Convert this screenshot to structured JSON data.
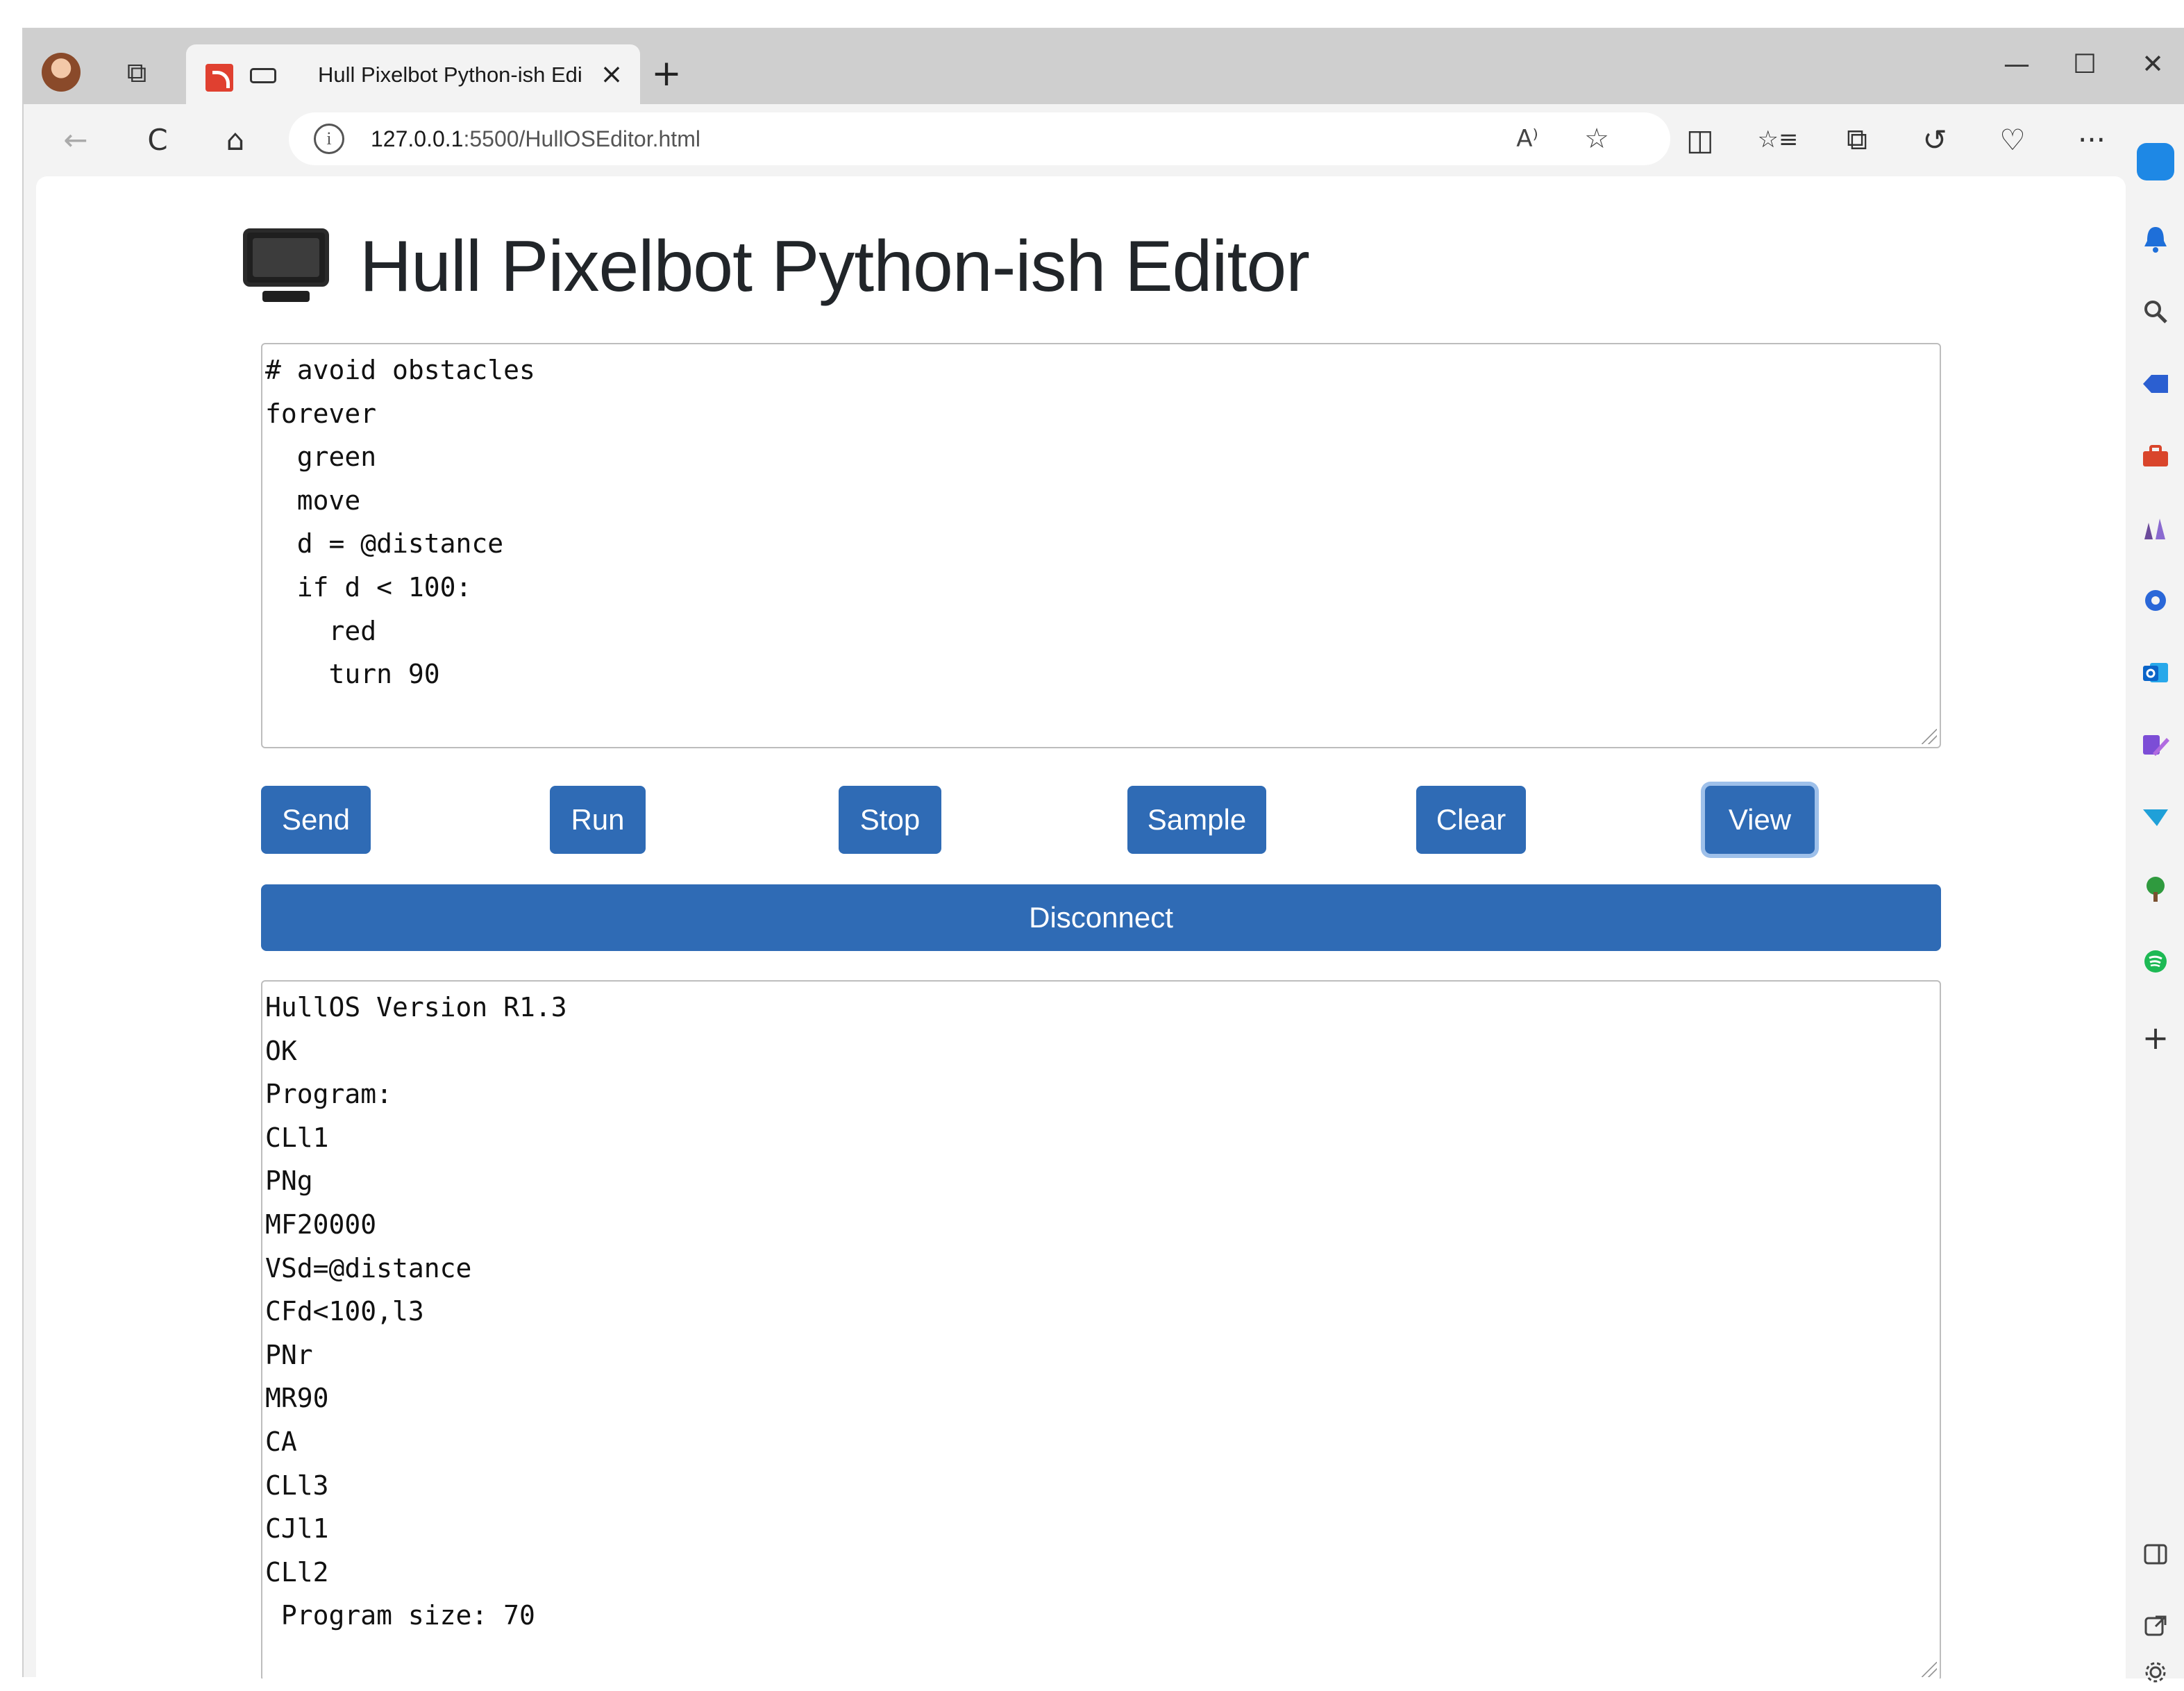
{
  "browser": {
    "tab_title": "Hull Pixelbot Python-ish Edi",
    "tab_close_glyph": "×",
    "new_tab_glyph": "+",
    "minimize_glyph": "—",
    "maximize_glyph": "☐",
    "close_glyph": "✕",
    "url_host": "127.0.0.1",
    "url_path": ":5500/HullOSEditor.html",
    "back_glyph": "←",
    "refresh_glyph": "C",
    "home_glyph": "⌂",
    "info_glyph": "i",
    "read_aloud_glyph": "A⁾",
    "favorite_glyph": "☆",
    "split_glyph": "◫",
    "favorites_glyph": "☆≡",
    "collections_glyph": "⧉",
    "history_glyph": "↺",
    "performance_glyph": "♡",
    "more_glyph": "···"
  },
  "sidebar": {
    "add_glyph": "+",
    "items": [
      {
        "icon": "copilot-icon",
        "color": "#1e88e5"
      },
      {
        "icon": "bell-icon",
        "color": "#1e6fd9"
      },
      {
        "icon": "search-icon",
        "color": "#444444"
      },
      {
        "icon": "shopping-tag-icon",
        "color": "#2b5fd1"
      },
      {
        "icon": "tools-icon",
        "color": "#d9452b"
      },
      {
        "icon": "games-icon",
        "color": "#6b4a9a"
      },
      {
        "icon": "office-icon",
        "color": "#2a67d8"
      },
      {
        "icon": "outlook-icon",
        "color": "#0a64c8"
      },
      {
        "icon": "designer-icon",
        "color": "#7c4dd6"
      },
      {
        "icon": "send-icon",
        "color": "#1fa0d8"
      },
      {
        "icon": "tree-icon",
        "color": "#2f9a3e"
      },
      {
        "icon": "spotify-icon",
        "color": "#1db954"
      }
    ]
  },
  "page": {
    "title": "Hull Pixelbot Python-ish Editor",
    "editor_lines": [
      "# avoid obstacles",
      "forever",
      "  green",
      "  move",
      "  d = @distance",
      "  if d < 100:",
      "    red",
      "    turn 90"
    ],
    "buttons": {
      "send": "Send",
      "run": "Run",
      "stop": "Stop",
      "sample": "Sample",
      "clear": "Clear",
      "view": "View"
    },
    "disconnect": "Disconnect",
    "output_lines": [
      "HullOS Version R1.3",
      "OK",
      "Program:",
      "CLl1",
      "PNg",
      "MF20000",
      "VSd=@distance",
      "CFd<100,l3",
      "PNr",
      "MR90",
      "CA",
      "CLl3",
      "CJl1",
      "CLl2",
      " Program size: 70"
    ]
  }
}
